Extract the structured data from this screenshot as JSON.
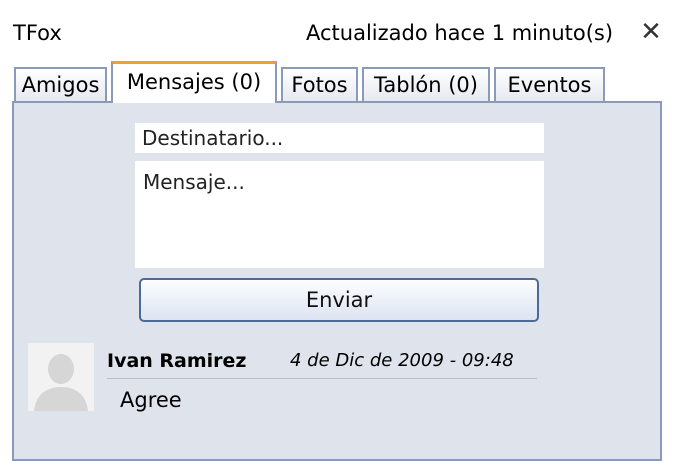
{
  "window": {
    "title": "TFox",
    "status": "Actualizado hace 1 minuto(s)",
    "close_label": "✕"
  },
  "tabs": [
    {
      "label": "Amigos",
      "active": false
    },
    {
      "label": "Mensajes (0)",
      "active": true
    },
    {
      "label": "Fotos",
      "active": false
    },
    {
      "label": "Tablón (0)",
      "active": false
    },
    {
      "label": "Eventos",
      "active": false
    }
  ],
  "compose": {
    "recipient_placeholder": "Destinatario...",
    "message_placeholder": "Mensaje...",
    "send_label": "Enviar"
  },
  "messages": [
    {
      "author": "Ivan Ramirez",
      "date": "4 de Dic de 2009 - 09:48",
      "text": "Agree",
      "avatar_icon": "default-user-silhouette-icon"
    }
  ],
  "colors": {
    "panel_bg": "#dfe3ec",
    "tab_border": "#8a9ab8",
    "active_tab_accent": "#f0a030",
    "button_border": "#4c6a98"
  }
}
